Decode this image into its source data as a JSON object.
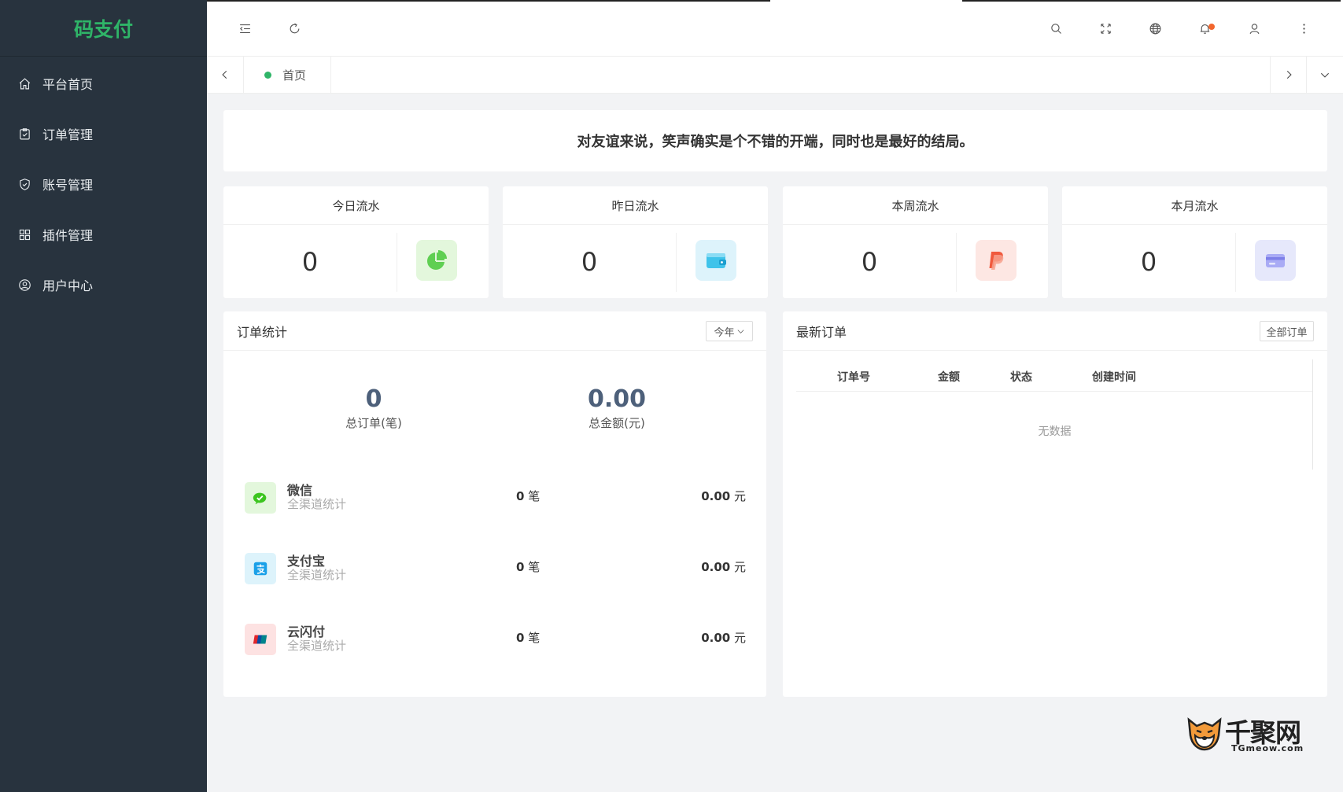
{
  "app": {
    "logo": "码支付",
    "brand_color": "#2fb568"
  },
  "sidebar": {
    "items": [
      {
        "label": "平台首页",
        "icon": "home-icon"
      },
      {
        "label": "订单管理",
        "icon": "order-icon"
      },
      {
        "label": "账号管理",
        "icon": "shield-icon"
      },
      {
        "label": "插件管理",
        "icon": "grid-icon"
      },
      {
        "label": "用户中心",
        "icon": "user-circle-icon"
      }
    ]
  },
  "header": {
    "icons": [
      "menu-fold-icon",
      "refresh-icon",
      "search-icon",
      "fullscreen-icon",
      "globe-icon",
      "bell-icon",
      "user-icon",
      "more-icon"
    ],
    "notify_color": "#f2662d"
  },
  "tabs": {
    "items": [
      {
        "label": "首页",
        "active": true
      }
    ]
  },
  "notice": {
    "text": "对友谊来说，笑声确实是个不错的开端，同时也是最好的结局。"
  },
  "stats": [
    {
      "title": "今日流水",
      "value": "0",
      "icon": "pie-chart-icon",
      "bg": "#e3f7dc",
      "color": "#5fcf52"
    },
    {
      "title": "昨日流水",
      "value": "0",
      "icon": "wallet-icon",
      "bg": "#ddf3fb",
      "color": "#3fc3ea"
    },
    {
      "title": "本周流水",
      "value": "0",
      "icon": "paypal-icon",
      "bg": "#fde7e3",
      "color": "#f0593d"
    },
    {
      "title": "本月流水",
      "value": "0",
      "icon": "card-icon",
      "bg": "#e6e8fb",
      "color": "#8f8ff0"
    }
  ],
  "order_stats": {
    "title": "订单统计",
    "filter_label": "今年",
    "total_orders": {
      "value": "0",
      "label": "总订单(笔)"
    },
    "total_amount": {
      "value": "0.00",
      "label": "总金额(元)"
    },
    "channels": [
      {
        "name": "微信",
        "sub": "全渠道统计",
        "count": "0",
        "count_unit": "笔",
        "amount": "0.00",
        "amount_unit": "元",
        "icon": "wechat-icon",
        "bg": "#e3f7dc",
        "color": "#3cc51f"
      },
      {
        "name": "支付宝",
        "sub": "全渠道统计",
        "count": "0",
        "count_unit": "笔",
        "amount": "0.00",
        "amount_unit": "元",
        "icon": "alipay-icon",
        "bg": "#ddf3fb",
        "color": "#1aa0e8"
      },
      {
        "name": "云闪付",
        "sub": "全渠道统计",
        "count": "0",
        "count_unit": "笔",
        "amount": "0.00",
        "amount_unit": "元",
        "icon": "unionpay-icon",
        "bg": "#fde2e2",
        "color": "#e0262d"
      }
    ]
  },
  "latest_orders": {
    "title": "最新订单",
    "all_button": "全部订单",
    "columns": [
      "订单号",
      "金额",
      "状态",
      "创建时间"
    ],
    "empty_text": "无数据"
  },
  "watermark": {
    "text": "千聚网",
    "sub": "TGmeow.com"
  }
}
